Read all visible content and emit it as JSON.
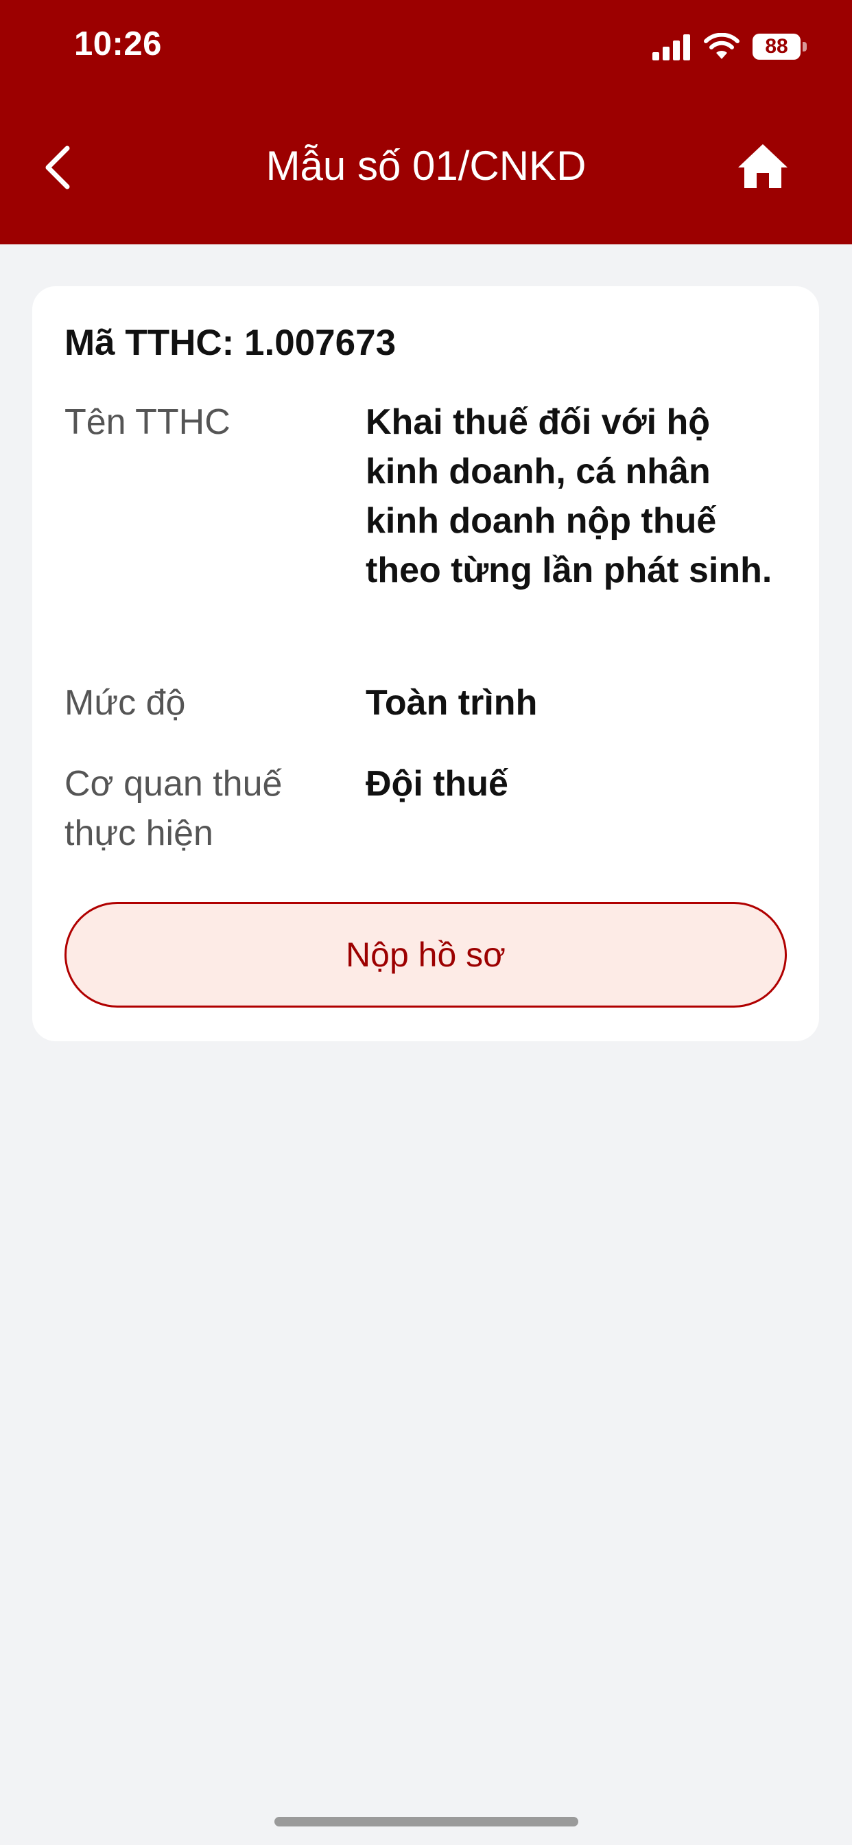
{
  "status_bar": {
    "time": "10:26",
    "battery": "88",
    "icons": [
      "signal-icon",
      "wifi-icon",
      "battery-icon"
    ]
  },
  "nav": {
    "title": "Mẫu số 01/CNKD",
    "back_icon": "chevron-left-icon",
    "home_icon": "home-icon"
  },
  "card": {
    "code": "Mã TTHC: 1.007673",
    "rows": [
      {
        "label": "Tên TTHC",
        "value": "Khai thuế đối với hộ kinh doanh, cá nhân kinh doanh nộp thuế theo từng lần phát sinh."
      },
      {
        "label": "Mức độ",
        "value": "Toàn trình"
      },
      {
        "label": "Cơ quan thuế thực hiện",
        "value": "Đội thuế"
      }
    ],
    "submit_label": "Nộp hồ sơ"
  },
  "colors": {
    "header": "#9c0000",
    "background": "#f2f3f5",
    "button_fill": "#fdebe6",
    "button_border": "#b00000",
    "button_text": "#9c0000"
  }
}
